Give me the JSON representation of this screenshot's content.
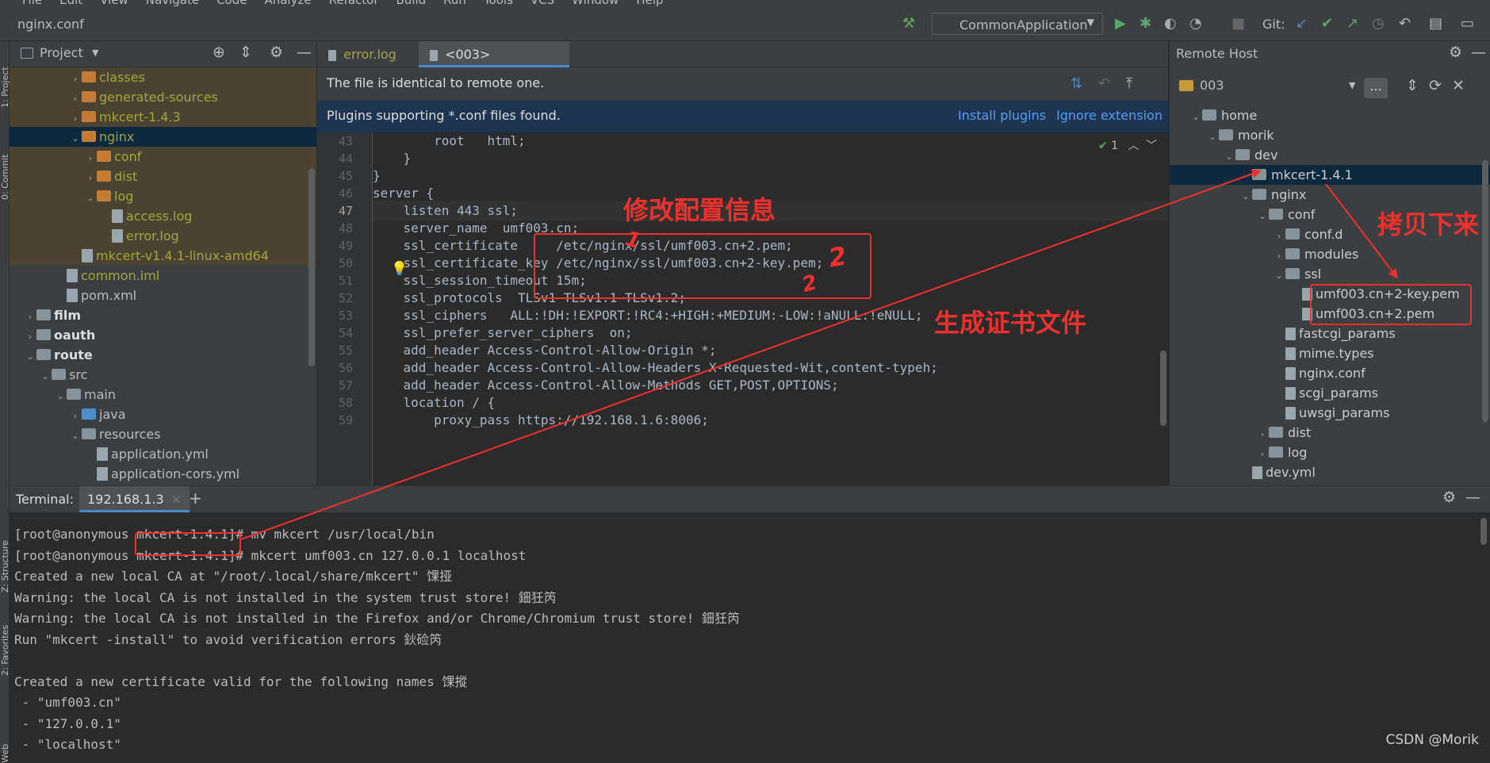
{
  "menubar": {
    "items": [
      "File",
      "Edit",
      "View",
      "Navigate",
      "Code",
      "Analyze",
      "Refactor",
      "Build",
      "Run",
      "Tools",
      "VCS",
      "Window",
      "Help"
    ]
  },
  "navbar": {
    "file": "nginx.conf",
    "run_config": "CommonApplication",
    "git_label": "Git:"
  },
  "project": {
    "title": "Project",
    "items": [
      {
        "label": "classes",
        "indent": 5,
        "kind": "folder-or",
        "arrow": "›",
        "style": "hl"
      },
      {
        "label": "generated-sources",
        "indent": 5,
        "kind": "folder-or",
        "arrow": "›",
        "style": "hl"
      },
      {
        "label": "mkcert-1.4.3",
        "indent": 5,
        "kind": "folder-or",
        "arrow": "›",
        "style": "hl"
      },
      {
        "label": "nginx",
        "indent": 5,
        "kind": "folder-or",
        "arrow": "⌄",
        "style": "sel"
      },
      {
        "label": "conf",
        "indent": 6,
        "kind": "folder-or",
        "arrow": "›",
        "style": "hl"
      },
      {
        "label": "dist",
        "indent": 6,
        "kind": "folder-or",
        "arrow": "›",
        "style": "hl"
      },
      {
        "label": "log",
        "indent": 6,
        "kind": "folder-or",
        "arrow": "⌄",
        "style": "hl"
      },
      {
        "label": "access.log",
        "indent": 7,
        "kind": "file",
        "arrow": "",
        "style": "hl"
      },
      {
        "label": "error.log",
        "indent": 7,
        "kind": "file",
        "arrow": "",
        "style": "hl"
      },
      {
        "label": "mkcert-v1.4.1-linux-amd64",
        "indent": 5,
        "kind": "file",
        "arrow": "",
        "style": "hl"
      },
      {
        "label": "common.iml",
        "indent": 4,
        "kind": "file",
        "arrow": "",
        "style": "ylw"
      },
      {
        "label": "pom.xml",
        "indent": 4,
        "kind": "file",
        "arrow": "",
        "style": ""
      },
      {
        "label": "film",
        "indent": 2,
        "kind": "folder",
        "arrow": "›",
        "style": "bold"
      },
      {
        "label": "oauth",
        "indent": 2,
        "kind": "folder",
        "arrow": "›",
        "style": "bold"
      },
      {
        "label": "route",
        "indent": 2,
        "kind": "folder",
        "arrow": "⌄",
        "style": "bold"
      },
      {
        "label": "src",
        "indent": 3,
        "kind": "folder",
        "arrow": "⌄",
        "style": ""
      },
      {
        "label": "main",
        "indent": 4,
        "kind": "folder",
        "arrow": "⌄",
        "style": ""
      },
      {
        "label": "java",
        "indent": 5,
        "kind": "folder-bl",
        "arrow": "›",
        "style": ""
      },
      {
        "label": "resources",
        "indent": 5,
        "kind": "folder",
        "arrow": "⌄",
        "style": ""
      },
      {
        "label": "application.yml",
        "indent": 6,
        "kind": "file",
        "arrow": "",
        "style": ""
      },
      {
        "label": "application-cors.yml",
        "indent": 6,
        "kind": "file",
        "arrow": "",
        "style": ""
      }
    ]
  },
  "editor": {
    "tabs": [
      {
        "label": "error.log"
      },
      {
        "label": "<003> nginx.conf"
      }
    ],
    "banner_identical": "The file is identical to remote one.",
    "banner_plugins": "Plugins supporting *.conf files found.",
    "install_plugins": "Install plugins",
    "ignore_extension": "Ignore extension",
    "inspection_count": "1",
    "lines": [
      {
        "n": "43",
        "text": "        root   html;"
      },
      {
        "n": "44",
        "text": "    }"
      },
      {
        "n": "45",
        "text": "}"
      },
      {
        "n": "46",
        "text": "server {"
      },
      {
        "n": "47",
        "text": "    listen 443 ssl;"
      },
      {
        "n": "48",
        "text": "    server_name  umf003.cn;"
      },
      {
        "n": "49",
        "text": "    ssl_certificate     /etc/nginx/ssl/umf003.cn+2.pem;"
      },
      {
        "n": "50",
        "text": "    ssl_certificate_key /etc/nginx/ssl/umf003.cn+2-key.pem;"
      },
      {
        "n": "51",
        "text": "    ssl_session_timeout 15m;"
      },
      {
        "n": "52",
        "text": "    ssl_protocols  TLSv1 TLSv1.1 TLSv1.2;"
      },
      {
        "n": "53",
        "text": "    ssl_ciphers   ALL:!DH:!EXPORT:!RC4:+HIGH:+MEDIUM:-LOW:!aNULL:!eNULL;"
      },
      {
        "n": "54",
        "text": "    ssl_prefer_server_ciphers  on;"
      },
      {
        "n": "55",
        "text": "    add_header Access-Control-Allow-Origin *;"
      },
      {
        "n": "56",
        "text": "    add_header Access-Control-Allow-Headers X-Requested-Wit,content-typeh;"
      },
      {
        "n": "57",
        "text": "    add_header Access-Control-Allow-Methods GET,POST,OPTIONS;"
      },
      {
        "n": "58",
        "text": "    location / {"
      },
      {
        "n": "59",
        "text": "        proxy_pass https://192.168.1.6:8006;"
      }
    ]
  },
  "remote": {
    "title": "Remote Host",
    "server": "003",
    "more_button": "...",
    "items": [
      {
        "label": "home",
        "indent": 1,
        "kind": "folder",
        "arrow": "⌄",
        "sel": false
      },
      {
        "label": "morik",
        "indent": 2,
        "kind": "folder",
        "arrow": "⌄",
        "sel": false
      },
      {
        "label": "dev",
        "indent": 3,
        "kind": "folder",
        "arrow": "⌄",
        "sel": false
      },
      {
        "label": "mkcert-1.4.1",
        "indent": 4,
        "kind": "folder",
        "arrow": "",
        "sel": true
      },
      {
        "label": "nginx",
        "indent": 4,
        "kind": "folder",
        "arrow": "⌄",
        "sel": false
      },
      {
        "label": "conf",
        "indent": 5,
        "kind": "folder",
        "arrow": "⌄",
        "sel": false
      },
      {
        "label": "conf.d",
        "indent": 6,
        "kind": "folder",
        "arrow": "›",
        "sel": false
      },
      {
        "label": "modules",
        "indent": 6,
        "kind": "folder",
        "arrow": "›",
        "sel": false
      },
      {
        "label": "ssl",
        "indent": 6,
        "kind": "folder",
        "arrow": "⌄",
        "sel": false
      },
      {
        "label": "umf003.cn+2-key.pem",
        "indent": 7,
        "kind": "file",
        "arrow": "",
        "sel": false
      },
      {
        "label": "umf003.cn+2.pem",
        "indent": 7,
        "kind": "file",
        "arrow": "",
        "sel": false
      },
      {
        "label": "fastcgi_params",
        "indent": 6,
        "kind": "file",
        "arrow": "",
        "sel": false
      },
      {
        "label": "mime.types",
        "indent": 6,
        "kind": "file",
        "arrow": "",
        "sel": false
      },
      {
        "label": "nginx.conf",
        "indent": 6,
        "kind": "file",
        "arrow": "",
        "sel": false
      },
      {
        "label": "scgi_params",
        "indent": 6,
        "kind": "file",
        "arrow": "",
        "sel": false
      },
      {
        "label": "uwsgi_params",
        "indent": 6,
        "kind": "file",
        "arrow": "",
        "sel": false
      },
      {
        "label": "dist",
        "indent": 5,
        "kind": "folder",
        "arrow": "›",
        "sel": false
      },
      {
        "label": "log",
        "indent": 5,
        "kind": "folder",
        "arrow": "›",
        "sel": false
      },
      {
        "label": "dev.yml",
        "indent": 4,
        "kind": "file",
        "arrow": "",
        "sel": false
      }
    ]
  },
  "terminal": {
    "label": "Terminal:",
    "tab": "192.168.1.3",
    "lines": [
      "[root@anonymous mkcert-1.4.1]# mv mkcert /usr/local/bin",
      "[root@anonymous mkcert-1.4.1]# mkcert umf003.cn 127.0.0.1 localhost",
      "Created a new local CA at \"/root/.local/share/mkcert\" 馃挜",
      "Warning: the local CA is not installed in the system trust store! 鈿狅笍",
      "Warning: the local CA is not installed in the Firefox and/or Chrome/Chromium trust store! 鈿狅笍",
      "Run \"mkcert -install\" to avoid verification errors 鈥硷笍",
      "",
      "Created a new certificate valid for the following names 馃摐",
      " - \"umf003.cn\"",
      " - \"127.0.0.1\"",
      " - \"localhost\""
    ]
  },
  "left_strip": {
    "project": "1: Project",
    "commit": "0: Commit",
    "structure": "Z: Structure",
    "favorites": "2: Favorites",
    "web": "Web"
  },
  "annotations": {
    "modify_config": "修改配置信息",
    "copy_down": "拷贝下来",
    "generate_cert": "生成证书文件",
    "mark_1": "1",
    "mark_2": "2"
  },
  "watermark": "CSDN @Morik",
  "colors": {
    "annotation": "#f0302c",
    "selection": "#0d293e",
    "excluded_bg": "#4a4331",
    "link": "#589df6"
  }
}
